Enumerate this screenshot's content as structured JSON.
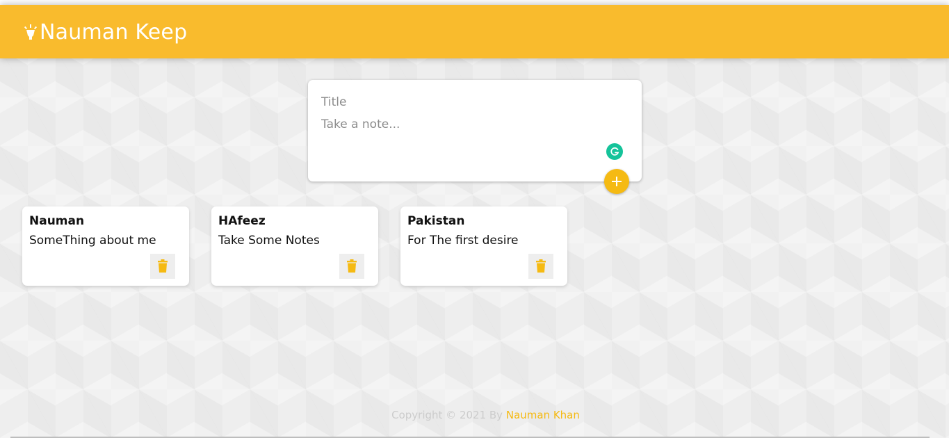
{
  "app": {
    "title": "Nauman Keep",
    "logo_icon": "highlight-bulb-icon",
    "accent_color": "#f9bb2d"
  },
  "create_note": {
    "title_placeholder": "Title",
    "content_placeholder": "Take a note...",
    "add_icon": "plus-icon",
    "grammarly_icon": "grammarly-icon"
  },
  "notes": [
    {
      "title": "Nauman",
      "content": "SomeThing about me",
      "delete_icon": "trash-icon"
    },
    {
      "title": "HAfeez",
      "content": "Take Some Notes",
      "delete_icon": "trash-icon"
    },
    {
      "title": "Pakistan",
      "content": "For The first desire",
      "delete_icon": "trash-icon"
    }
  ],
  "footer": {
    "prefix": "Copyright © 2021 By",
    "author": "Nauman Khan"
  }
}
